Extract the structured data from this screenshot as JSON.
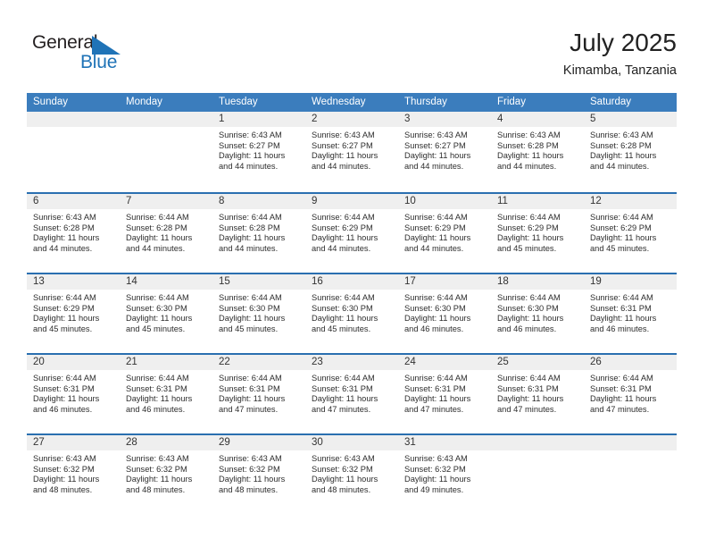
{
  "brand": {
    "name_part1": "General",
    "name_part2": "Blue",
    "triangle_icon": "triangle-icon",
    "accent_color": "#1f73b7"
  },
  "header": {
    "title": "July 2025",
    "subtitle": "Kimamba, Tanzania"
  },
  "theme": {
    "header_bar_color": "#3b7dbd",
    "row_divider_color": "#2a6fb0",
    "date_band_color": "#efefef",
    "text_color": "#2d2d2d"
  },
  "weekdays": [
    "Sunday",
    "Monday",
    "Tuesday",
    "Wednesday",
    "Thursday",
    "Friday",
    "Saturday"
  ],
  "weeks": [
    [
      {
        "date": "",
        "empty": true,
        "sunrise": "",
        "sunset": "",
        "daylight_line1": "",
        "daylight_line2": ""
      },
      {
        "date": "",
        "empty": true,
        "sunrise": "",
        "sunset": "",
        "daylight_line1": "",
        "daylight_line2": ""
      },
      {
        "date": "1",
        "empty": false,
        "sunrise": "Sunrise: 6:43 AM",
        "sunset": "Sunset: 6:27 PM",
        "daylight_line1": "Daylight: 11 hours",
        "daylight_line2": "and 44 minutes."
      },
      {
        "date": "2",
        "empty": false,
        "sunrise": "Sunrise: 6:43 AM",
        "sunset": "Sunset: 6:27 PM",
        "daylight_line1": "Daylight: 11 hours",
        "daylight_line2": "and 44 minutes."
      },
      {
        "date": "3",
        "empty": false,
        "sunrise": "Sunrise: 6:43 AM",
        "sunset": "Sunset: 6:27 PM",
        "daylight_line1": "Daylight: 11 hours",
        "daylight_line2": "and 44 minutes."
      },
      {
        "date": "4",
        "empty": false,
        "sunrise": "Sunrise: 6:43 AM",
        "sunset": "Sunset: 6:28 PM",
        "daylight_line1": "Daylight: 11 hours",
        "daylight_line2": "and 44 minutes."
      },
      {
        "date": "5",
        "empty": false,
        "sunrise": "Sunrise: 6:43 AM",
        "sunset": "Sunset: 6:28 PM",
        "daylight_line1": "Daylight: 11 hours",
        "daylight_line2": "and 44 minutes."
      }
    ],
    [
      {
        "date": "6",
        "empty": false,
        "sunrise": "Sunrise: 6:43 AM",
        "sunset": "Sunset: 6:28 PM",
        "daylight_line1": "Daylight: 11 hours",
        "daylight_line2": "and 44 minutes."
      },
      {
        "date": "7",
        "empty": false,
        "sunrise": "Sunrise: 6:44 AM",
        "sunset": "Sunset: 6:28 PM",
        "daylight_line1": "Daylight: 11 hours",
        "daylight_line2": "and 44 minutes."
      },
      {
        "date": "8",
        "empty": false,
        "sunrise": "Sunrise: 6:44 AM",
        "sunset": "Sunset: 6:28 PM",
        "daylight_line1": "Daylight: 11 hours",
        "daylight_line2": "and 44 minutes."
      },
      {
        "date": "9",
        "empty": false,
        "sunrise": "Sunrise: 6:44 AM",
        "sunset": "Sunset: 6:29 PM",
        "daylight_line1": "Daylight: 11 hours",
        "daylight_line2": "and 44 minutes."
      },
      {
        "date": "10",
        "empty": false,
        "sunrise": "Sunrise: 6:44 AM",
        "sunset": "Sunset: 6:29 PM",
        "daylight_line1": "Daylight: 11 hours",
        "daylight_line2": "and 44 minutes."
      },
      {
        "date": "11",
        "empty": false,
        "sunrise": "Sunrise: 6:44 AM",
        "sunset": "Sunset: 6:29 PM",
        "daylight_line1": "Daylight: 11 hours",
        "daylight_line2": "and 45 minutes."
      },
      {
        "date": "12",
        "empty": false,
        "sunrise": "Sunrise: 6:44 AM",
        "sunset": "Sunset: 6:29 PM",
        "daylight_line1": "Daylight: 11 hours",
        "daylight_line2": "and 45 minutes."
      }
    ],
    [
      {
        "date": "13",
        "empty": false,
        "sunrise": "Sunrise: 6:44 AM",
        "sunset": "Sunset: 6:29 PM",
        "daylight_line1": "Daylight: 11 hours",
        "daylight_line2": "and 45 minutes."
      },
      {
        "date": "14",
        "empty": false,
        "sunrise": "Sunrise: 6:44 AM",
        "sunset": "Sunset: 6:30 PM",
        "daylight_line1": "Daylight: 11 hours",
        "daylight_line2": "and 45 minutes."
      },
      {
        "date": "15",
        "empty": false,
        "sunrise": "Sunrise: 6:44 AM",
        "sunset": "Sunset: 6:30 PM",
        "daylight_line1": "Daylight: 11 hours",
        "daylight_line2": "and 45 minutes."
      },
      {
        "date": "16",
        "empty": false,
        "sunrise": "Sunrise: 6:44 AM",
        "sunset": "Sunset: 6:30 PM",
        "daylight_line1": "Daylight: 11 hours",
        "daylight_line2": "and 45 minutes."
      },
      {
        "date": "17",
        "empty": false,
        "sunrise": "Sunrise: 6:44 AM",
        "sunset": "Sunset: 6:30 PM",
        "daylight_line1": "Daylight: 11 hours",
        "daylight_line2": "and 46 minutes."
      },
      {
        "date": "18",
        "empty": false,
        "sunrise": "Sunrise: 6:44 AM",
        "sunset": "Sunset: 6:30 PM",
        "daylight_line1": "Daylight: 11 hours",
        "daylight_line2": "and 46 minutes."
      },
      {
        "date": "19",
        "empty": false,
        "sunrise": "Sunrise: 6:44 AM",
        "sunset": "Sunset: 6:31 PM",
        "daylight_line1": "Daylight: 11 hours",
        "daylight_line2": "and 46 minutes."
      }
    ],
    [
      {
        "date": "20",
        "empty": false,
        "sunrise": "Sunrise: 6:44 AM",
        "sunset": "Sunset: 6:31 PM",
        "daylight_line1": "Daylight: 11 hours",
        "daylight_line2": "and 46 minutes."
      },
      {
        "date": "21",
        "empty": false,
        "sunrise": "Sunrise: 6:44 AM",
        "sunset": "Sunset: 6:31 PM",
        "daylight_line1": "Daylight: 11 hours",
        "daylight_line2": "and 46 minutes."
      },
      {
        "date": "22",
        "empty": false,
        "sunrise": "Sunrise: 6:44 AM",
        "sunset": "Sunset: 6:31 PM",
        "daylight_line1": "Daylight: 11 hours",
        "daylight_line2": "and 47 minutes."
      },
      {
        "date": "23",
        "empty": false,
        "sunrise": "Sunrise: 6:44 AM",
        "sunset": "Sunset: 6:31 PM",
        "daylight_line1": "Daylight: 11 hours",
        "daylight_line2": "and 47 minutes."
      },
      {
        "date": "24",
        "empty": false,
        "sunrise": "Sunrise: 6:44 AM",
        "sunset": "Sunset: 6:31 PM",
        "daylight_line1": "Daylight: 11 hours",
        "daylight_line2": "and 47 minutes."
      },
      {
        "date": "25",
        "empty": false,
        "sunrise": "Sunrise: 6:44 AM",
        "sunset": "Sunset: 6:31 PM",
        "daylight_line1": "Daylight: 11 hours",
        "daylight_line2": "and 47 minutes."
      },
      {
        "date": "26",
        "empty": false,
        "sunrise": "Sunrise: 6:44 AM",
        "sunset": "Sunset: 6:31 PM",
        "daylight_line1": "Daylight: 11 hours",
        "daylight_line2": "and 47 minutes."
      }
    ],
    [
      {
        "date": "27",
        "empty": false,
        "sunrise": "Sunrise: 6:43 AM",
        "sunset": "Sunset: 6:32 PM",
        "daylight_line1": "Daylight: 11 hours",
        "daylight_line2": "and 48 minutes."
      },
      {
        "date": "28",
        "empty": false,
        "sunrise": "Sunrise: 6:43 AM",
        "sunset": "Sunset: 6:32 PM",
        "daylight_line1": "Daylight: 11 hours",
        "daylight_line2": "and 48 minutes."
      },
      {
        "date": "29",
        "empty": false,
        "sunrise": "Sunrise: 6:43 AM",
        "sunset": "Sunset: 6:32 PM",
        "daylight_line1": "Daylight: 11 hours",
        "daylight_line2": "and 48 minutes."
      },
      {
        "date": "30",
        "empty": false,
        "sunrise": "Sunrise: 6:43 AM",
        "sunset": "Sunset: 6:32 PM",
        "daylight_line1": "Daylight: 11 hours",
        "daylight_line2": "and 48 minutes."
      },
      {
        "date": "31",
        "empty": false,
        "sunrise": "Sunrise: 6:43 AM",
        "sunset": "Sunset: 6:32 PM",
        "daylight_line1": "Daylight: 11 hours",
        "daylight_line2": "and 49 minutes."
      },
      {
        "date": "",
        "empty": true,
        "sunrise": "",
        "sunset": "",
        "daylight_line1": "",
        "daylight_line2": ""
      },
      {
        "date": "",
        "empty": true,
        "sunrise": "",
        "sunset": "",
        "daylight_line1": "",
        "daylight_line2": ""
      }
    ]
  ]
}
